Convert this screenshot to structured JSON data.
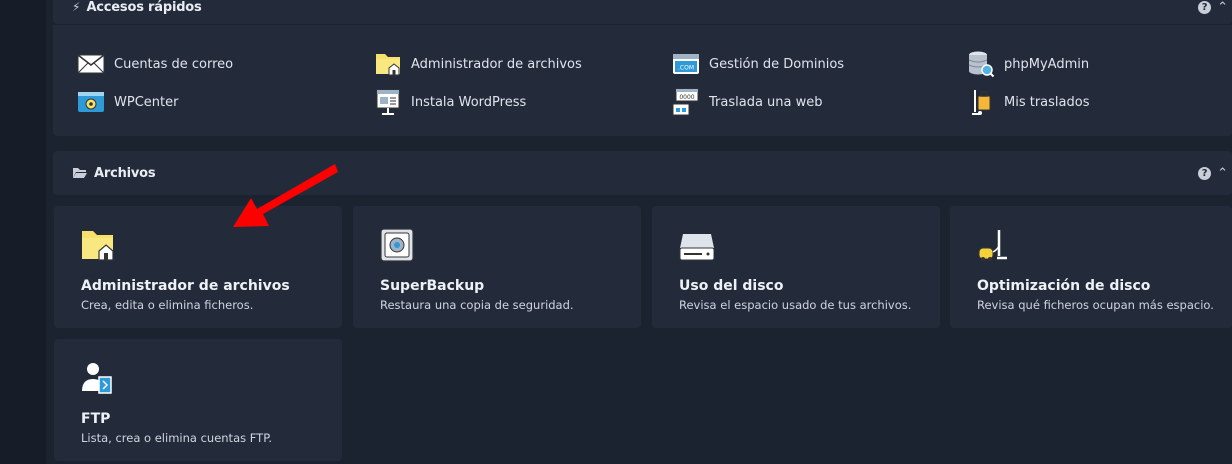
{
  "quick_access": {
    "title": "Accesos rápidos",
    "items": [
      {
        "label": "Cuentas de correo",
        "icon": "mail-icon"
      },
      {
        "label": "Administrador de archivos",
        "icon": "folder-home-icon"
      },
      {
        "label": "Gestión de Dominios",
        "icon": "domain-com-icon"
      },
      {
        "label": "phpMyAdmin",
        "icon": "database-icon"
      },
      {
        "label": "WPCenter",
        "icon": "wpcenter-icon"
      },
      {
        "label": "Instala WordPress",
        "icon": "install-wordpress-icon"
      },
      {
        "label": "Traslada una web",
        "icon": "migrate-web-icon"
      },
      {
        "label": "Mis traslados",
        "icon": "luggage-icon"
      }
    ]
  },
  "files_section": {
    "title": "Archivos",
    "cards": [
      {
        "title": "Administrador de archivos",
        "desc": "Crea, edita o elimina ficheros.",
        "icon": "folder-home-icon"
      },
      {
        "title": "SuperBackup",
        "desc": "Restaura una copia de seguridad.",
        "icon": "safe-icon"
      },
      {
        "title": "Uso del disco",
        "desc": "Revisa el espacio usado de tus archivos.",
        "icon": "hard-drive-icon"
      },
      {
        "title": "Optimización de disco",
        "desc": "Revisa qué ficheros ocupan más espacio.",
        "icon": "vacuum-cleaner-icon"
      },
      {
        "title": "FTP",
        "desc": "Lista, crea o elimina cuentas FTP.",
        "icon": "ftp-user-icon"
      }
    ]
  },
  "controls": {
    "help": "?",
    "collapse": "^"
  },
  "colors": {
    "background": "#1b2230",
    "panel": "#232b3b",
    "accent_arrow": "#ff0000",
    "folder_yellow": "#f7e06b"
  }
}
